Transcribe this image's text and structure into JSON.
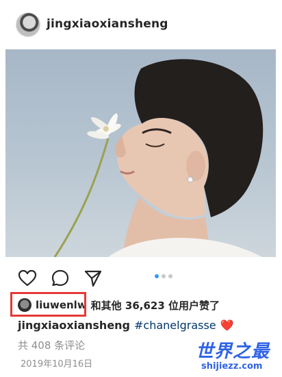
{
  "post": {
    "username": "jingxiaoxiansheng"
  },
  "likes": {
    "liker_name": "liuwenlw",
    "suffix": "和其他 36,623 位用户赞了"
  },
  "caption": {
    "username": "jingxiaoxiansheng",
    "hashtag": "#chanelgrasse",
    "emoji": "❤️"
  },
  "comments": {
    "text": "共 408 条评论"
  },
  "date": {
    "text": "2019年10月16日"
  },
  "carousel": {
    "count": 3,
    "active_index": 0
  },
  "watermark": {
    "title": "世界之最",
    "domain": "shijiezz.com"
  },
  "colors": {
    "accent_blue": "#3897f0",
    "hashtag_blue": "#00376b",
    "highlight_red": "#e53935",
    "watermark_blue": "#2f63e6"
  }
}
